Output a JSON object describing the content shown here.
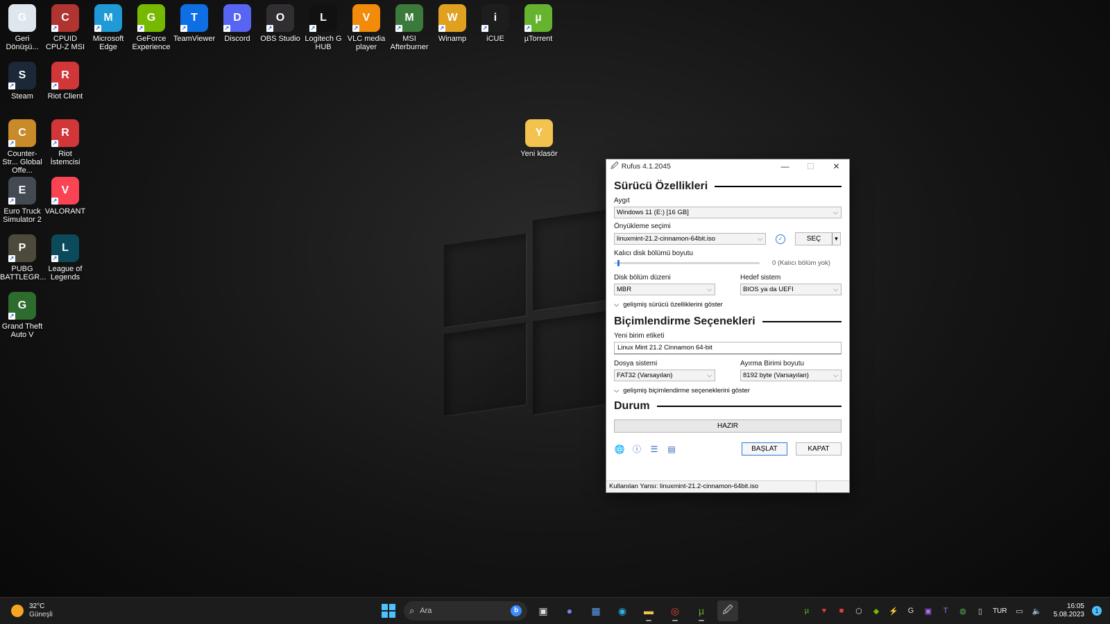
{
  "desktop_icons": [
    {
      "label": "Geri Dönüşü...",
      "icon": "recycle-bin-icon",
      "color": "#dfe7ee"
    },
    {
      "label": "CPUID CPU-Z MSI",
      "icon": "cpuz-icon",
      "color": "#b0342f"
    },
    {
      "label": "Microsoft Edge",
      "icon": "edge-icon",
      "color": "#1f9ad6"
    },
    {
      "label": "GeForce Experience",
      "icon": "nvidia-icon",
      "color": "#76b900"
    },
    {
      "label": "TeamViewer",
      "icon": "teamviewer-icon",
      "color": "#0e6ee3"
    },
    {
      "label": "Discord",
      "icon": "discord-icon",
      "color": "#5865f2"
    },
    {
      "label": "OBS Studio",
      "icon": "obs-icon",
      "color": "#302e31"
    },
    {
      "label": "Logitech G HUB",
      "icon": "logitech-icon",
      "color": "#111111"
    },
    {
      "label": "VLC media player",
      "icon": "vlc-icon",
      "color": "#f28a0a"
    },
    {
      "label": "MSI Afterburner",
      "icon": "afterburner-icon",
      "color": "#3a7a3a"
    },
    {
      "label": "Winamp",
      "icon": "winamp-icon",
      "color": "#e0a020"
    },
    {
      "label": "iCUE",
      "icon": "icue-icon",
      "color": "#1d1d1d"
    },
    {
      "label": "µTorrent",
      "icon": "utorrent-icon",
      "color": "#65b32e"
    },
    {
      "label": "Steam",
      "icon": "steam-icon",
      "color": "#1b2838"
    },
    {
      "label": "Riot Client",
      "icon": "riot-icon",
      "color": "#d13639"
    },
    {
      "label": "Counter-Str... Global Offe...",
      "icon": "csgo-icon",
      "color": "#c98a2a"
    },
    {
      "label": "Riot İstemcisi",
      "icon": "riot-icon",
      "color": "#d13639"
    },
    {
      "label": "Euro Truck Simulator 2",
      "icon": "ets2-icon",
      "color": "#444a52"
    },
    {
      "label": "VALORANT",
      "icon": "valorant-icon",
      "color": "#fa4454"
    },
    {
      "label": "PUBG BATTLEGR...",
      "icon": "pubg-icon",
      "color": "#4d4a3c"
    },
    {
      "label": "League of Legends",
      "icon": "lol-icon",
      "color": "#0a4a5a"
    },
    {
      "label": "Grand Theft Auto V",
      "icon": "gta-icon",
      "color": "#2e6b2e"
    },
    {
      "label": "Yeni klasör",
      "icon": "folder-icon",
      "color": "#f3c24f"
    }
  ],
  "rufus": {
    "title": "Rufus 4.1.2045",
    "section_drive": "Sürücü Özellikleri",
    "device_label": "Aygıt",
    "device_value": "Windows 11 (E:) [16 GB]",
    "boot_label": "Önyükleme seçimi",
    "boot_value": "linuxmint-21.2-cinnamon-64bit.iso",
    "select_button": "SEÇ",
    "persistent_label": "Kalıcı disk bölümü boyutu",
    "persistent_value": "0 (Kalıcı bölüm yok)",
    "partition_label": "Disk bölüm düzeni",
    "partition_value": "MBR",
    "target_label": "Hedef sistem",
    "target_value": "BIOS ya da UEFI",
    "adv_drive": "gelişmiş sürücü özelliklerini göster",
    "section_format": "Biçimlendirme Seçenekleri",
    "volume_label": "Yeni birim etiketi",
    "volume_value": "Linux Mint 21.2 Cinnamon 64-bit",
    "fs_label": "Dosya sistemi",
    "fs_value": "FAT32 (Varsayılan)",
    "cluster_label": "Ayırma Birimi boyutu",
    "cluster_value": "8192 byte (Varsayılan)",
    "adv_format": "gelişmiş biçimlendirme seçeneklerini göster",
    "section_status": "Durum",
    "status_value": "HAZIR",
    "start_button": "BAŞLAT",
    "close_button": "KAPAT",
    "statusbar": "Kullanılan Yansı: linuxmint-21.2-cinnamon-64bit.iso"
  },
  "taskbar": {
    "weather_temp": "32°C",
    "weather_desc": "Güneşli",
    "search_placeholder": "Ara",
    "language": "TUR",
    "time": "16:05",
    "date": "5.08.2023",
    "notification_count": "1"
  },
  "colors": {
    "accent": "#4cc2ff",
    "rufus_blue": "#2b78d8"
  }
}
